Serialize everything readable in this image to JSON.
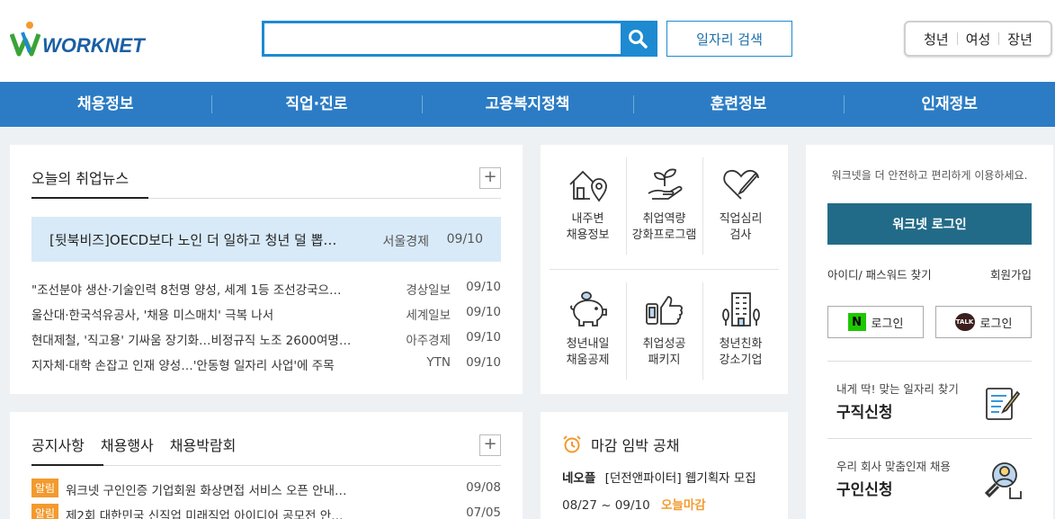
{
  "header": {
    "logo_text": "WORKNET",
    "search_placeholder": "",
    "job_search_label": "일자리 검색",
    "targets": [
      "청년",
      "여성",
      "장년"
    ]
  },
  "nav": [
    "채용정보",
    "직업·진로",
    "고용복지정책",
    "훈련정보",
    "인재정보"
  ],
  "news": {
    "tab": "오늘의 취업뉴스",
    "more": "+",
    "headline": {
      "title": "[뒷북비즈]OECD보다 노인 더 일하고 청년 덜 뽑…",
      "source": "서울경제",
      "date": "09/10"
    },
    "items": [
      {
        "title": "\"조선분야 생산·기술인력 8천명 양성, 세계 1등 조선강국으…",
        "source": "경상일보",
        "date": "09/10"
      },
      {
        "title": "울산대·한국석유공사, '채용 미스매치' 극복 나서",
        "source": "세계일보",
        "date": "09/10"
      },
      {
        "title": "현대제철, '직고용' 기싸움 장기화…비정규직 노조 2600여명…",
        "source": "아주경제",
        "date": "09/10"
      },
      {
        "title": "지자체·대학 손잡고 인재 양성…'안동형 일자리 사업'에 주목",
        "source": "YTN",
        "date": "09/10"
      }
    ]
  },
  "notice": {
    "tabs": [
      "공지사항",
      "채용행사",
      "채용박람회"
    ],
    "more": "+",
    "items": [
      {
        "badge": "알림",
        "title": "워크넷 구인인증 기업회원 화상면접 서비스 오픈 안내…",
        "date": "09/08"
      },
      {
        "badge": "알림",
        "title": "제2회 대한민국 신직업 미래직업 아이디어 공모전 안…",
        "date": "07/05"
      }
    ]
  },
  "services": [
    {
      "label": "내주변\n채용정보",
      "icon": "house-location-icon"
    },
    {
      "label": "취업역량\n강화프로그램",
      "icon": "sprout-hand-icon"
    },
    {
      "label": "직업심리\n검사",
      "icon": "heart-pen-icon"
    },
    {
      "label": "청년내일\n채움공제",
      "icon": "piggy-bank-icon"
    },
    {
      "label": "취업성공\n패키지",
      "icon": "thumbs-up-phone-icon"
    },
    {
      "label": "청년친화\n강소기업",
      "icon": "building-icon"
    }
  ],
  "deadline": {
    "title": "마감 임박 공채",
    "company": "네오플",
    "job": "[던전앤파이터] 웹기획자 모집",
    "period": "08/27 ~ 09/10",
    "status": "오늘마감"
  },
  "login": {
    "desc": "워크넷을 더 안전하고 편리하게 이용하세요.",
    "button": "워크넷 로그인",
    "find": "아이디/ 패스워드 찾기",
    "join": "회원가입",
    "naver_mark": "N",
    "naver_label": "로그인",
    "kakao_mark": "TALK",
    "kakao_label": "로그인"
  },
  "cards": [
    {
      "sub": "내게 딱! 맞는 일자리 찾기",
      "title": "구직신청"
    },
    {
      "sub": "우리 회사 맞춤인재 채용",
      "title": "구인신청"
    }
  ],
  "colors": {
    "primary": "#2b7cc5",
    "search": "#1d8ad2",
    "login": "#226b88",
    "accent": "#f39a2e",
    "headline_bg": "#d8eaf8"
  }
}
